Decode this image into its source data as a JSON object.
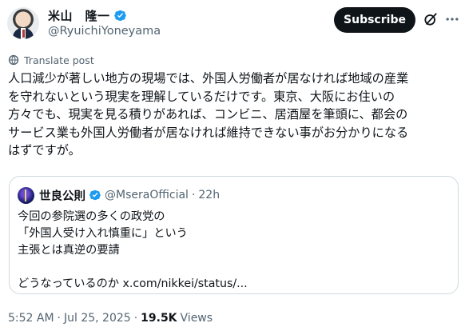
{
  "author": {
    "display_name": "米山　隆一",
    "handle": "@RyuichiYoneyama",
    "verified": true,
    "avatar_icon": "avatar"
  },
  "actions": {
    "subscribe_label": "Subscribe",
    "grok_icon": "grok-icon",
    "more_icon": "more-icon"
  },
  "translate": {
    "label": "Translate post",
    "icon": "globe-icon"
  },
  "tweet": {
    "lines": [
      "人口減少が著しい地方の現場では、外国人労働者が居なければ地域の産業",
      "を守れないという現実を理解しているだけです。東京、大阪にお住いの",
      "方々でも、現実を見る積りがあれば、コンビニ、居酒屋を筆頭に、都会の",
      "サービス業も外国人労働者が居なければ維持できない事がお分かりになる",
      "はずですが。"
    ]
  },
  "quote": {
    "display_name": "世良公則",
    "handle": "@MseraOfficial",
    "separator": "·",
    "time": "22h",
    "verified": true,
    "lines": [
      "今回の参院選の多くの政党の",
      "「外国人受け入れ慎重に」という",
      "主張とは真逆の要請",
      "",
      "どうなっているのか x.com/nikkei/status/..."
    ]
  },
  "meta": {
    "time": "5:52 AM",
    "separator": "·",
    "date": "Jul 25, 2025",
    "views_count": "19.5K",
    "views_label": "Views"
  },
  "colors": {
    "text": "#0f1419",
    "secondary": "#536471",
    "verified": "#1d9bf0",
    "border": "#cfd9de",
    "button_bg": "#0f1419"
  }
}
